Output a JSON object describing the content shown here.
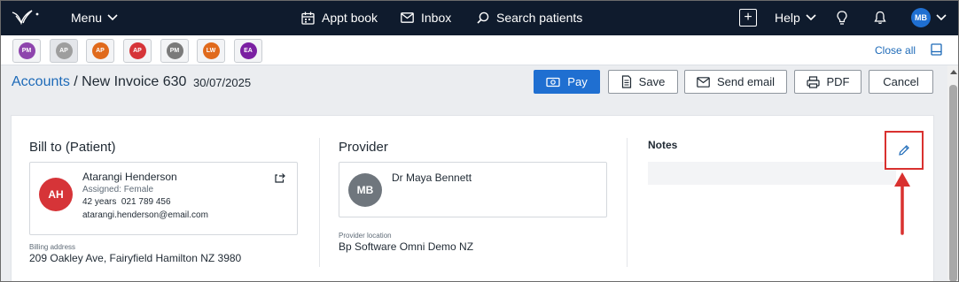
{
  "topnav": {
    "menu_label": "Menu",
    "appt_label": "Appt book",
    "inbox_label": "Inbox",
    "search_label": "Search patients",
    "add_icon": "+",
    "help_label": "Help",
    "user_initials": "MB"
  },
  "patient_tabs": [
    {
      "initials": "PM",
      "color": "#8e44ad"
    },
    {
      "initials": "AP",
      "color": "#9e9e9e"
    },
    {
      "initials": "AP",
      "color": "#e06a1c"
    },
    {
      "initials": "AP",
      "color": "#d63438"
    },
    {
      "initials": "PM",
      "color": "#7a7a7a"
    },
    {
      "initials": "LW",
      "color": "#e06a1c"
    },
    {
      "initials": "EA",
      "color": "#7a1fa2"
    }
  ],
  "close_all_label": "Close all",
  "breadcrumb": {
    "parent": "Accounts",
    "separator": " / ",
    "current": "New Invoice 630",
    "date": "30/07/2025"
  },
  "actions": {
    "pay": "Pay",
    "save": "Save",
    "send_email": "Send email",
    "pdf": "PDF",
    "cancel": "Cancel"
  },
  "bill_to": {
    "title": "Bill to (Patient)",
    "initials": "AH",
    "avatar_color": "#d63438",
    "name": "Atarangi Henderson",
    "assigned": "Assigned: Female",
    "age": "42 years",
    "phone": "021 789 456",
    "email": "atarangi.henderson@email.com",
    "billing_label": "Billing address",
    "billing_address": "209 Oakley Ave, Fairyfield Hamilton NZ 3980"
  },
  "provider": {
    "title": "Provider",
    "initials": "MB",
    "avatar_color": "#6f767d",
    "name": "Dr Maya Bennett",
    "location_label": "Provider location",
    "location": "Bp Software Omni Demo NZ"
  },
  "notes": {
    "title": "Notes"
  },
  "colors": {
    "nav_bg": "#0f1b2d",
    "primary": "#1f6fd1",
    "link": "#1d6ab8",
    "highlight": "#d9312f"
  }
}
